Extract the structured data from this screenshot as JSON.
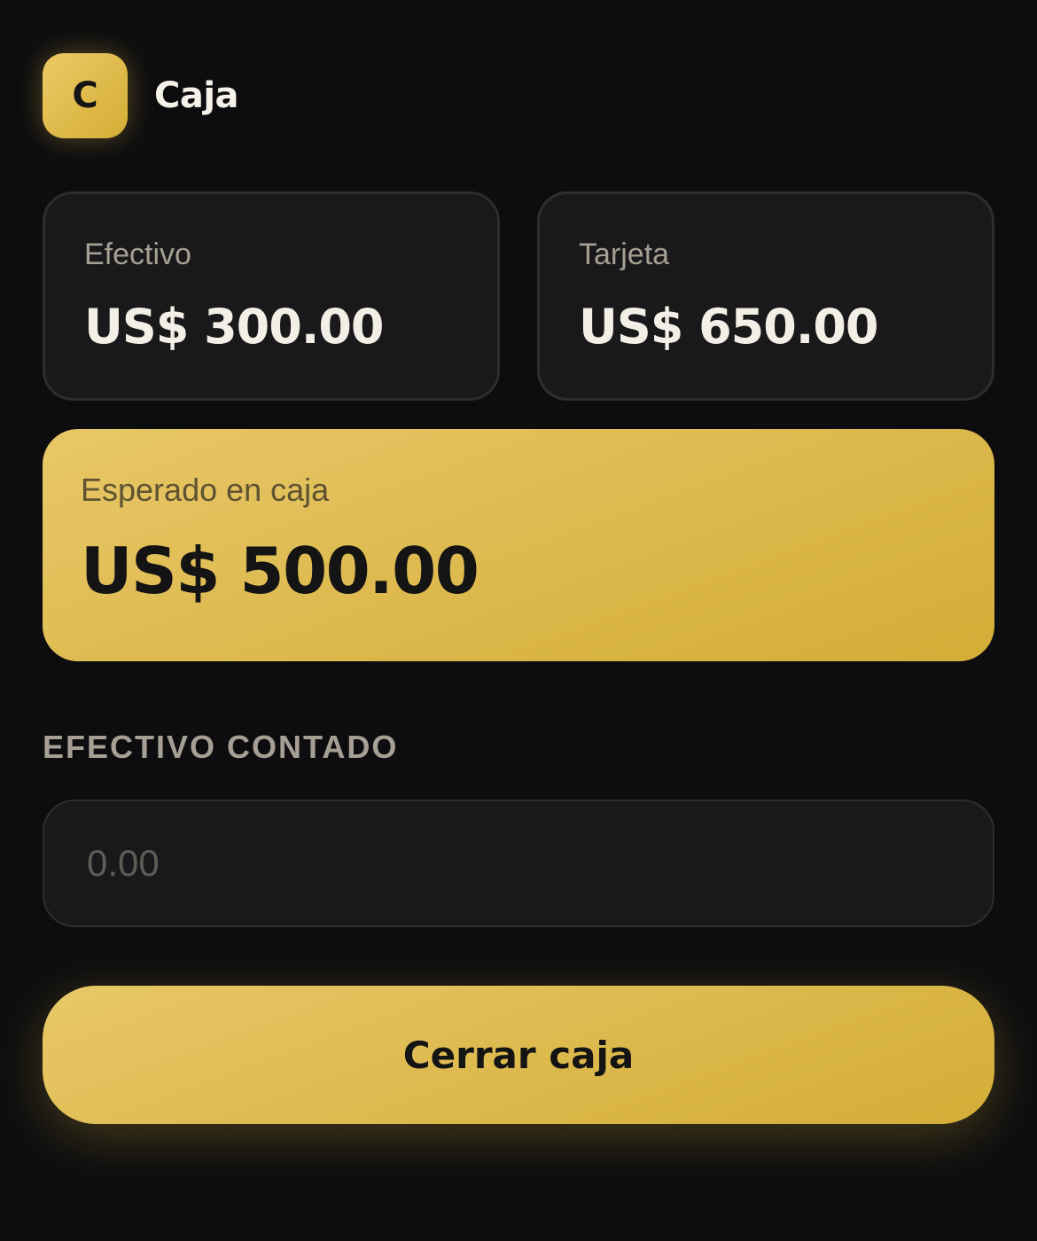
{
  "header": {
    "logo_letter": "C",
    "title": "Caja"
  },
  "summary": {
    "cash": {
      "label": "Efectivo",
      "value": "US$ 300.00"
    },
    "card": {
      "label": "Tarjeta",
      "value": "US$ 650.00"
    }
  },
  "expected": {
    "label": "Esperado en caja",
    "value": "US$ 500.00"
  },
  "counted": {
    "label": "EFECTIVO CONTADO",
    "placeholder": "0.00"
  },
  "actions": {
    "close_label": "Cerrar caja"
  },
  "colors": {
    "background": "#0d0d0f",
    "accent": "#e0bd52",
    "card_background": "#19191b",
    "muted_text": "#a59f94"
  }
}
